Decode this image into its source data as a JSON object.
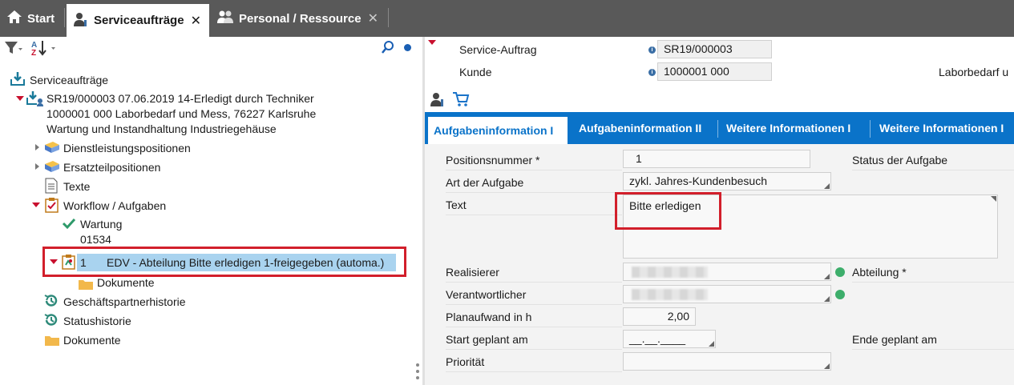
{
  "tabs": [
    {
      "label": "Start",
      "icon": "home-icon"
    },
    {
      "label": "Serviceaufträge",
      "icon": "service-user-icon",
      "close": "✕"
    },
    {
      "label": "Personal / Ressource",
      "icon": "people-icon",
      "close": "✕"
    }
  ],
  "tree": {
    "root": "Serviceaufträge",
    "order_line1": "SR19/000003 07.06.2019 14-Erledigt durch Techniker",
    "order_line2": "1000001 000 Laborbedarf und Mess, 76227 Karlsruhe",
    "order_line3": "Wartung und Instandhaltung Industriegehäuse",
    "items": {
      "dienstleistung": "Dienstleistungspositionen",
      "ersatzteil": "Ersatzteilpositionen",
      "texte": "Texte",
      "workflow": "Workflow / Aufgaben",
      "wartung": "Wartung",
      "wartung_nr": "01534",
      "task_nr": "1",
      "task_text": "EDV - Abteilung  Bitte erledigen  1-freigegeben (automa.)",
      "task_docs": "Dokumente",
      "partner_hist": "Geschäftspartnerhistorie",
      "status_hist": "Statushistorie",
      "docs": "Dokumente"
    }
  },
  "header": {
    "service_label": "Service-Auftrag",
    "service_value": "SR19/000003",
    "kunde_label": "Kunde",
    "kunde_value": "1000001 000",
    "kunde_name": "Laborbedarf u"
  },
  "subtabs": [
    "Aufgabeninformation I",
    "Aufgabeninformation II",
    "Weitere Informationen I",
    "Weitere Informationen I"
  ],
  "form": {
    "pos_label": "Positionsnummer *",
    "pos_value": "1",
    "status_label": "Status der Aufgabe",
    "art_label": "Art der Aufgabe",
    "art_value": "zykl. Jahres-Kundenbesuch",
    "text_label": "Text",
    "text_value": "Bitte erledigen",
    "real_label": "Realisierer",
    "abt_label": "Abteilung *",
    "verant_label": "Verantwortlicher",
    "plan_label": "Planaufwand in h",
    "plan_value": "2,00",
    "start_label": "Start geplant am",
    "start_value": "__.__.____",
    "ende_label": "Ende geplant am",
    "prio_label": "Priorität"
  },
  "colors": {
    "accent": "#0a73c9",
    "highlight": "#d21f2b",
    "tabbar": "#595959",
    "status_ok": "#3dae6b"
  }
}
